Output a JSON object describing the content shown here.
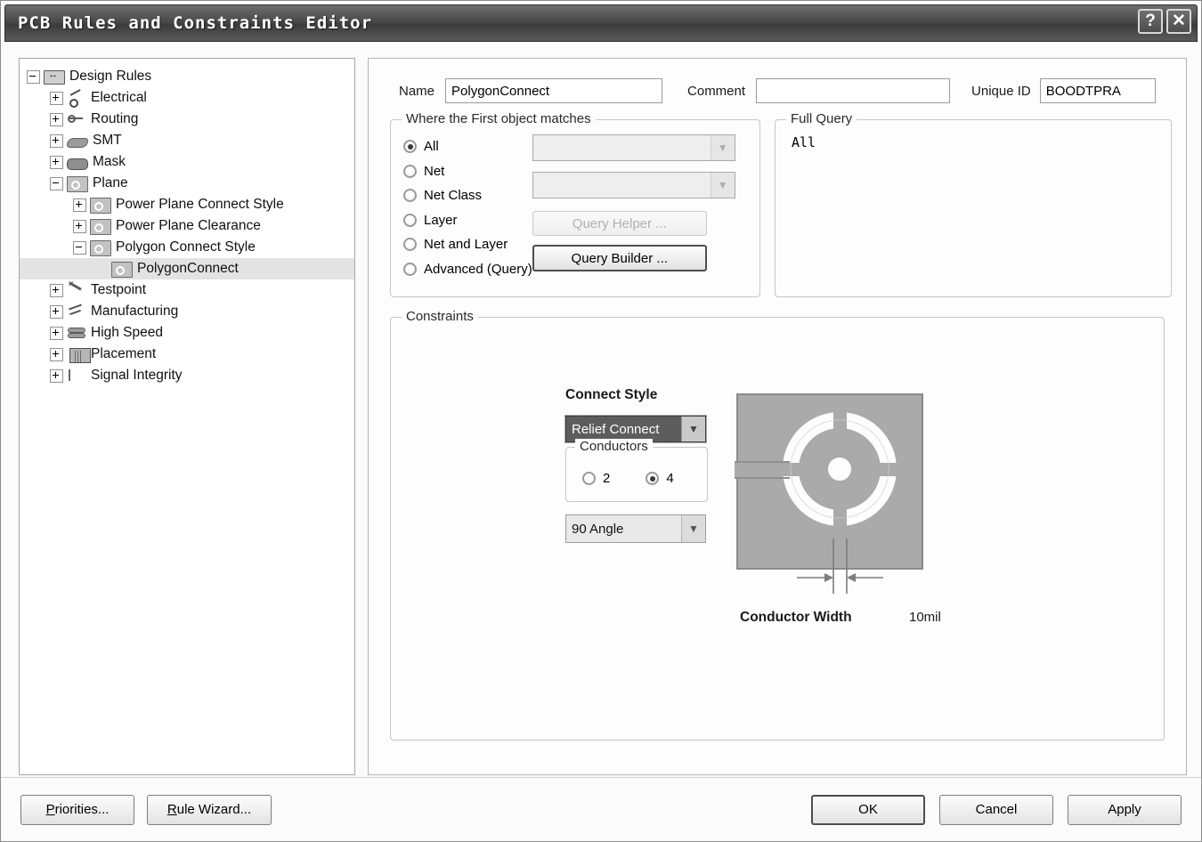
{
  "window": {
    "title": "PCB Rules and Constraints Editor",
    "help_button": "?",
    "close_button": "✕"
  },
  "tree": {
    "nodes": [
      {
        "label": "Design Rules",
        "depth": 0,
        "expander": "minus",
        "icon": "design-rules-icon",
        "selected": false
      },
      {
        "label": "Electrical",
        "depth": 1,
        "expander": "plus",
        "icon": "electrical-icon",
        "selected": false
      },
      {
        "label": "Routing",
        "depth": 1,
        "expander": "plus",
        "icon": "routing-icon",
        "selected": false
      },
      {
        "label": "SMT",
        "depth": 1,
        "expander": "plus",
        "icon": "smt-icon",
        "selected": false
      },
      {
        "label": "Mask",
        "depth": 1,
        "expander": "plus",
        "icon": "mask-icon",
        "selected": false
      },
      {
        "label": "Plane",
        "depth": 1,
        "expander": "minus",
        "icon": "plane-icon",
        "selected": false
      },
      {
        "label": "Power Plane Connect Style",
        "depth": 2,
        "expander": "plus",
        "icon": "plane-icon",
        "selected": false
      },
      {
        "label": "Power Plane Clearance",
        "depth": 2,
        "expander": "plus",
        "icon": "plane-icon",
        "selected": false
      },
      {
        "label": "Polygon Connect Style",
        "depth": 2,
        "expander": "minus",
        "icon": "plane-icon",
        "selected": false
      },
      {
        "label": "PolygonConnect",
        "depth": 3,
        "expander": "none",
        "icon": "plane-icon",
        "selected": true
      },
      {
        "label": "Testpoint",
        "depth": 1,
        "expander": "plus",
        "icon": "testpoint-icon",
        "selected": false
      },
      {
        "label": "Manufacturing",
        "depth": 1,
        "expander": "plus",
        "icon": "manufacturing-icon",
        "selected": false
      },
      {
        "label": "High Speed",
        "depth": 1,
        "expander": "plus",
        "icon": "high-speed-icon",
        "selected": false
      },
      {
        "label": "Placement",
        "depth": 1,
        "expander": "plus",
        "icon": "placement-icon",
        "selected": false
      },
      {
        "label": "Signal Integrity",
        "depth": 1,
        "expander": "plus",
        "icon": "signal-integrity-icon",
        "selected": false
      }
    ]
  },
  "header": {
    "name_label": "Name",
    "name_value": "PolygonConnect",
    "comment_label": "Comment",
    "comment_value": "",
    "unique_id_label": "Unique ID",
    "unique_id_value": "BOODTPRA"
  },
  "matches": {
    "legend": "Where the First object matches",
    "options": [
      {
        "label": "All",
        "selected": true
      },
      {
        "label": "Net",
        "selected": false
      },
      {
        "label": "Net Class",
        "selected": false
      },
      {
        "label": "Layer",
        "selected": false
      },
      {
        "label": "Net and Layer",
        "selected": false
      },
      {
        "label": "Advanced (Query)",
        "selected": false
      }
    ],
    "net_combo_value": "",
    "net_class_combo_value": "",
    "query_helper_label": "Query Helper ...",
    "query_builder_label": "Query Builder ..."
  },
  "full_query": {
    "legend": "Full Query",
    "text": "All"
  },
  "constraints": {
    "legend": "Constraints",
    "connect_style_label": "Connect Style",
    "connect_style_value": "Relief Connect",
    "conductors_legend": "Conductors",
    "conductors": [
      {
        "label": "2",
        "selected": false
      },
      {
        "label": "4",
        "selected": true
      }
    ],
    "angle_value": "90 Angle",
    "conductor_width_label": "Conductor Width",
    "conductor_width_value": "10mil"
  },
  "footer": {
    "priorities_label": "Priorities...",
    "priorities_accel": "P",
    "rule_wizard_label": "Rule Wizard...",
    "rule_wizard_accel": "R",
    "ok_label": "OK",
    "cancel_label": "Cancel",
    "apply_label": "Apply"
  },
  "colors": {
    "titlebar": "#4a4a4a",
    "selection": "#e3e3e3",
    "combo_selected_bg": "#5d5d5d",
    "pad_fill": "#aaaaaa",
    "window_bg": "#fbfbfb"
  }
}
